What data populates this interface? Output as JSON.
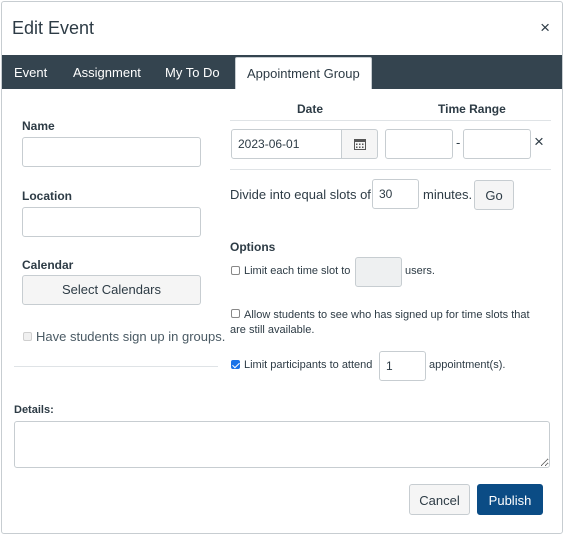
{
  "dialog": {
    "title": "Edit Event",
    "close_glyph": "×"
  },
  "tabs": [
    {
      "label": "Event"
    },
    {
      "label": "Assignment"
    },
    {
      "label": "My To Do"
    },
    {
      "label": "Appointment Group"
    }
  ],
  "left": {
    "name_label": "Name",
    "name_value": "",
    "location_label": "Location",
    "location_value": "",
    "calendar_label": "Calendar",
    "select_calendars_button": "Select Calendars",
    "groups_checkbox_label": "Have students sign up in groups."
  },
  "schedule": {
    "date_header": "Date",
    "time_range_header": "Time Range",
    "date_value": "2023-06-01",
    "start_time": "",
    "end_time": "",
    "dash": "-",
    "remove_glyph": "×",
    "divide_text_before": "Divide into equal slots of",
    "slot_minutes": "30",
    "divide_text_after": "minutes.",
    "go_button": "Go"
  },
  "options": {
    "header": "Options",
    "limit_slot_label_before": "Limit each time slot to",
    "limit_slot_value": "",
    "limit_slot_label_after": "users.",
    "allow_see_label": "Allow students to see who has signed up for time slots that are still available.",
    "limit_participants_label_before": "Limit participants to attend",
    "limit_participants_value": "1",
    "limit_participants_label_after": "appointment(s)."
  },
  "details": {
    "label": "Details:",
    "value": ""
  },
  "footer": {
    "cancel_button": "Cancel",
    "publish_button": "Publish"
  },
  "colors": {
    "tab_bar": "#34444f",
    "primary": "#0b4c85",
    "checkbox": "#1a73e8"
  }
}
